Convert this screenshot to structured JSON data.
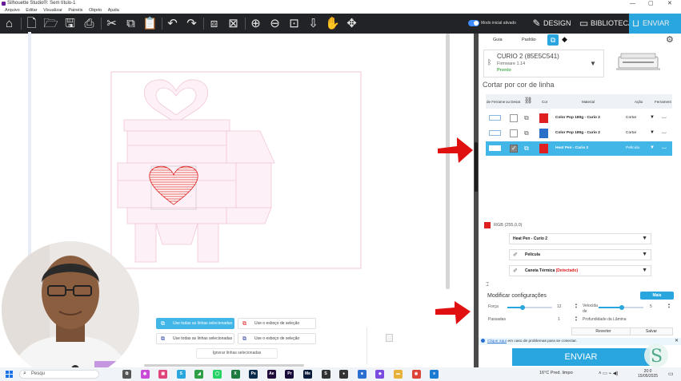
{
  "window": {
    "title": "Silhouette Studio®: Sem título-1",
    "controls": [
      "—",
      "▢",
      "✕"
    ]
  },
  "menu": [
    "Arquivo",
    "Editar",
    "Visualizar",
    "Painéis",
    "Objeto",
    "Ajuda"
  ],
  "toolbar": {
    "icons": [
      "home-icon",
      "new-doc-icon",
      "open-folder-icon",
      "save-icon",
      "print-icon",
      "cut-icon",
      "copy-icon",
      "paste-icon",
      "undo-icon",
      "redo-icon",
      "group-icon",
      "ungroup-icon",
      "zoom-in-icon",
      "zoom-out-icon",
      "zoom-fit-icon",
      "move-down-icon",
      "pan-hand-icon",
      "fit-page-icon"
    ],
    "beginner_mode_label": "Modo inicial ativado",
    "tabs": {
      "design": "DESIGN",
      "library": "BIBLIOTECA",
      "send": "ENVIAR"
    }
  },
  "panel": {
    "tabs": [
      "Guia",
      "Padrão"
    ],
    "device": {
      "name": "CURIO 2 (85E5C541)",
      "firmware": "Firmware 1.14",
      "status": "Pronto"
    },
    "section_title": "Cortar por cor de linha",
    "table": {
      "headers": [
        "de Ferrame",
        "ou Desat",
        "",
        "Cor",
        "Material",
        "Ação",
        "Ferrament"
      ],
      "rows": [
        {
          "color": "#e02020",
          "material": "Color Pop 180g - Curio 2",
          "action": "Cortar",
          "checked": false,
          "selected": false
        },
        {
          "color": "#2a6fc8",
          "material": "Color Pop 180g - Curio 2",
          "action": "Cortar",
          "checked": false,
          "selected": false
        },
        {
          "color": "#e02020",
          "material": "Heat Pen - Curio 2",
          "action": "Película",
          "checked": true,
          "selected": true
        }
      ]
    },
    "rgb_label": "RGB (255,0,0)",
    "material_select": "Heat Pen - Curio 2",
    "action_select": "Película",
    "tool_select_prefix": "Caneta Térmica",
    "tool_select_status": "(Detectado)",
    "modify_title": "Modificar configurações",
    "more_button": "Mais",
    "settings": {
      "force_label": "Força",
      "force_value": "12",
      "speed_label_1": "Velocida",
      "speed_label_2": "de",
      "speed_value": "5",
      "passes_label": "Passadas",
      "passes_value": "1",
      "blade_depth_label": "Profundidade da Lâmina"
    },
    "revert_button": "Reverter",
    "save_button": "Salvar",
    "help": {
      "link": "Clique aqui",
      "text": "em caso de problemas para se conectar."
    },
    "send_button": "ENVIAR"
  },
  "canvas_buttons": {
    "use_all_selected_1": "Use todas as linhas selecionadas",
    "use_outline_1": "Use o esboço de seleção",
    "use_all_selected_2": "Use todas as linhas selecionadas",
    "use_outline_2": "Use o esboço de seleção",
    "ignore": "Ignorar linhas selecionadas"
  },
  "taskbar": {
    "search": "Pesqu",
    "apps": [
      {
        "name": "task-view",
        "label": "⧉",
        "color": "#555"
      },
      {
        "name": "copilot",
        "label": "◉",
        "color": "#c84cd6"
      },
      {
        "name": "gallery",
        "label": "▣",
        "color": "#e0457a"
      },
      {
        "name": "silhouette",
        "label": "S",
        "color": "#2aa6de"
      },
      {
        "name": "app-green",
        "label": "◢",
        "color": "#2e9e46"
      },
      {
        "name": "whatsapp",
        "label": "◯",
        "color": "#25d366"
      },
      {
        "name": "excel",
        "label": "X",
        "color": "#1d7a3e"
      },
      {
        "name": "photoshop",
        "label": "Ps",
        "color": "#0a2a4a"
      },
      {
        "name": "after-effects",
        "label": "Ae",
        "color": "#1f0a3a"
      },
      {
        "name": "premiere",
        "label": "Pr",
        "color": "#1a0a3a"
      },
      {
        "name": "media-encoder",
        "label": "Me",
        "color": "#0a1a3a"
      },
      {
        "name": "app-s",
        "label": "S",
        "color": "#333"
      },
      {
        "name": "app-dark",
        "label": "●",
        "color": "#333"
      },
      {
        "name": "app-blue",
        "label": "■",
        "color": "#2a6fd1"
      },
      {
        "name": "app-purple",
        "label": "◆",
        "color": "#7b4ae0"
      },
      {
        "name": "explorer",
        "label": "▬",
        "color": "#e8b23a"
      },
      {
        "name": "chrome",
        "label": "◉",
        "color": "#db4437"
      },
      {
        "name": "edge",
        "label": "e",
        "color": "#1b7bd1"
      }
    ],
    "weather": "16°C  Pred. limpo",
    "time": "20:0",
    "date": "15/05/2025"
  }
}
